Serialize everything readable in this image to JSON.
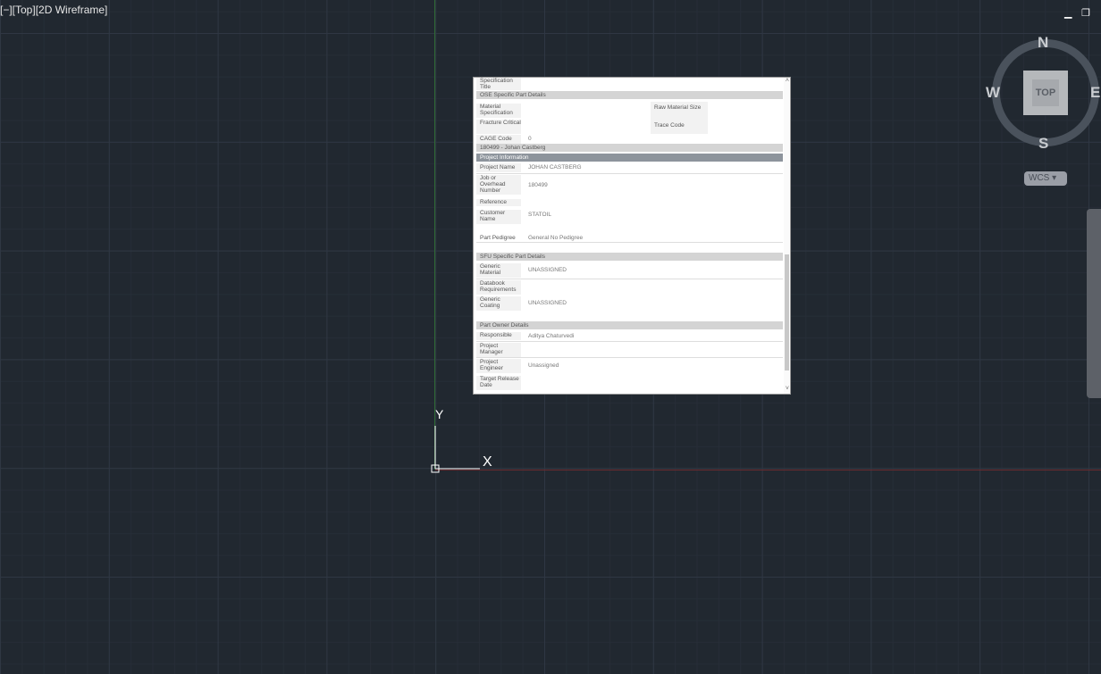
{
  "viewport": {
    "label": "[−][Top][2D Wireframe]"
  },
  "window": {
    "minimize": "▁",
    "restore": "❐"
  },
  "ucs": {
    "x": "X",
    "y": "Y"
  },
  "viewcube": {
    "n": "N",
    "s": "S",
    "e": "E",
    "w": "W",
    "face": "TOP",
    "wcs": "WCS"
  },
  "table": {
    "spec_title": "Specification Title",
    "ose_header": "OSE Specific Part Details",
    "material_spec": "Material Specification",
    "raw_material_size": "Raw Material Size",
    "fracture_critical": "Fracture Critical",
    "trace_code": "Trace Code",
    "cage_code_label": "CAGE Code",
    "cage_code_value": "0",
    "project_header": "180499 - Johan Castberg",
    "project_info": "Project Information",
    "project_name_label": "Project Name",
    "project_name_value": "JOHAN CASTBERG",
    "job_label": "Job or Overhead Number",
    "job_value": "180499",
    "reference_label": "Reference",
    "customer_label": "Customer Name",
    "customer_value": "STATOIL",
    "pedigree_label": "Part Pedigree",
    "pedigree_value": "General No Pedigree",
    "sfu_header": "SFU Specific Part Details",
    "generic_material_label": "Generic Material",
    "generic_material_value": "UNASSIGNED",
    "databook_label": "Databook Requirements",
    "generic_coating_label": "Generic Coating",
    "generic_coating_value": "UNASSIGNED",
    "owner_header": "Part Owner Details",
    "responsible_label": "Responsible",
    "responsible_value": "Aditya Chaturvedi",
    "pm_label": "Project Manager",
    "pe_label": "Project Engineer",
    "pe_value": "Unassigned",
    "target_label": "Target Release Date"
  }
}
